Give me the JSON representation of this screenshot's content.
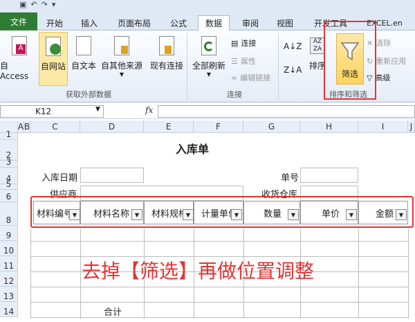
{
  "tabs": {
    "file": "文件",
    "items": [
      "开始",
      "插入",
      "页面布局",
      "公式",
      "数据",
      "审阅",
      "视图",
      "开发工具"
    ],
    "active": "数据",
    "brand": "EXCEL.en"
  },
  "ribbon": {
    "ext_data": {
      "access": "自 Access",
      "web": "自网站",
      "text": "自文本",
      "other": "自其他来源",
      "existing": "现有连接",
      "group": "获取外部数据"
    },
    "connections": {
      "refresh_all": "全部刷新",
      "connect": "连接",
      "properties": "属性",
      "edit_links": "编辑链接",
      "group": "连接"
    },
    "sort_filter": {
      "sort": "排序",
      "filter": "筛选",
      "clear": "清除",
      "reapply": "重新应用",
      "advanced": "高级",
      "group": "排序和筛选"
    }
  },
  "formula_bar": {
    "name_box": "K12",
    "fx": "fx"
  },
  "columns": [
    "A",
    "B",
    "C",
    "D",
    "E",
    "F",
    "G",
    "H",
    "I",
    "J"
  ],
  "rows": [
    "1",
    "2",
    "3",
    "4",
    "5",
    "6",
    "7",
    "8",
    "9",
    "10",
    "11",
    "12",
    "13",
    "14"
  ],
  "sheet": {
    "title": "入库单",
    "date_label": "入库日期",
    "order_no_label": "单号",
    "supplier_label": "供应商",
    "warehouse_label": "收货仓库",
    "headers": [
      "材料编号",
      "材料名称",
      "材料规格",
      "计量单位",
      "数量",
      "单价",
      "金额"
    ],
    "total_label": "合计"
  },
  "annotation": "去掉【筛选】再做位置调整",
  "colors": {
    "accent_red": "#e63333",
    "file_tab": "#2e7d32",
    "ribbon_bg": "#dfe8f5"
  }
}
